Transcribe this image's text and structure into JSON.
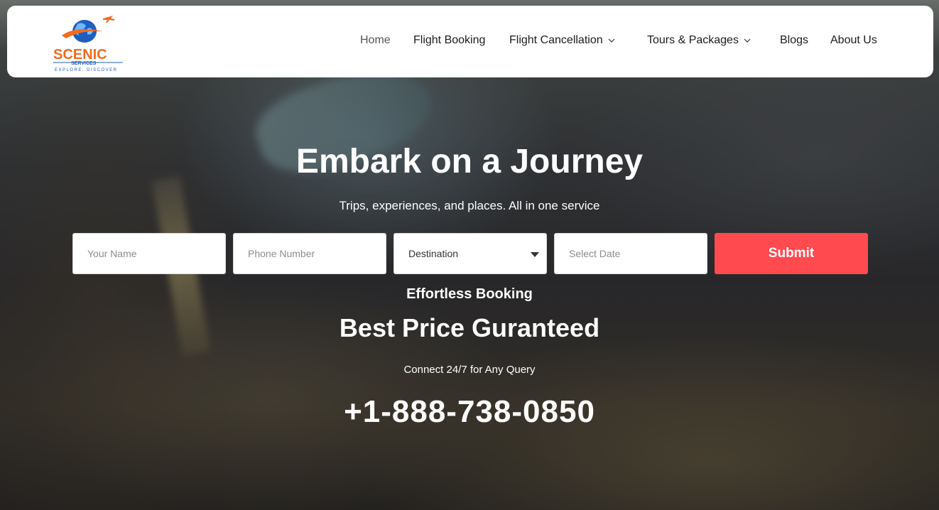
{
  "brand": {
    "name": "SCENIC",
    "sub": "SERVICES",
    "tagline": "EXPLORE. DISCOVER",
    "colors": {
      "orange": "#f26b1d",
      "blue": "#1f5fbf",
      "accent": "#ff4a4f"
    }
  },
  "nav": {
    "items": [
      {
        "label": "Home",
        "active": true
      },
      {
        "label": "Flight Booking"
      },
      {
        "label": "Flight Cancellation",
        "icon": "chevron-down-icon"
      },
      {
        "label": "Tours & Packages",
        "icon": "chevron-down-icon"
      },
      {
        "label": "Blogs"
      },
      {
        "label": "About Us"
      }
    ]
  },
  "hero": {
    "title": "Embark on a Journey",
    "subtitle": "Trips, experiences, and places. All in one service"
  },
  "form": {
    "name_placeholder": "Your Name",
    "phone_placeholder": "Phone Number",
    "destination_value": "Destination",
    "date_placeholder": "Select Date",
    "submit_label": "Submit"
  },
  "promo": {
    "line1": "Effortless Booking",
    "line2": "Best Price Guranteed",
    "line3": "Connect 24/7 for Any Query",
    "phone": "+1-888-738-0850"
  }
}
